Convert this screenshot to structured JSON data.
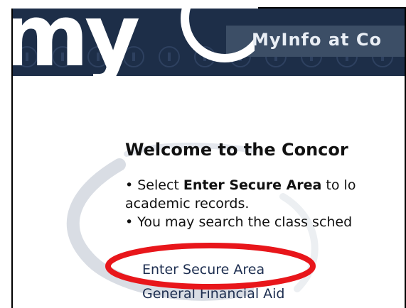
{
  "banner": {
    "logo_text": "my",
    "title": "MyInfo at Co"
  },
  "main": {
    "welcome_heading": "Welcome to the Concor",
    "bullet1_pre": "• Select ",
    "bullet1_bold": "Enter Secure Area",
    "bullet1_post": " to lo",
    "bullet1_cont": "academic records.",
    "bullet2": "• You may search the class sched"
  },
  "links": {
    "secure_area": "Enter Secure Area",
    "financial_aid": "General Financial Aid"
  },
  "colors": {
    "banner_bg": "#1d2e48",
    "highlight": "#e8161b",
    "link": "#1d2e50"
  }
}
